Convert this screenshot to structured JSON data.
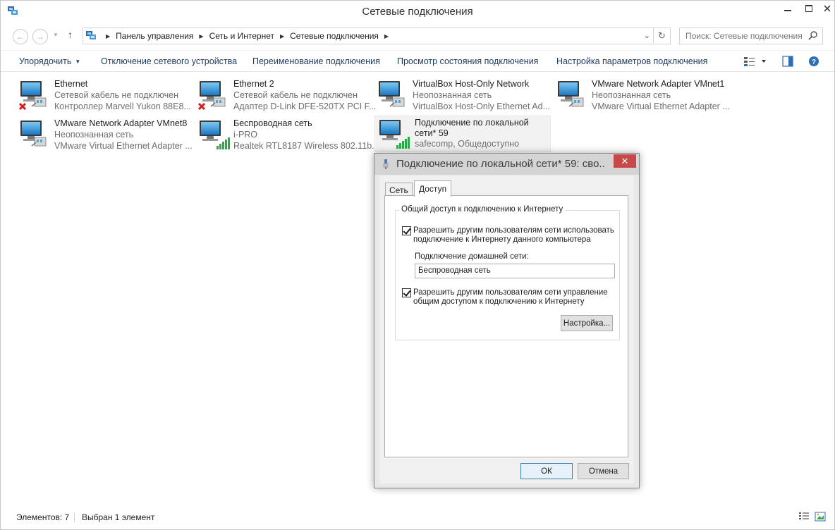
{
  "window": {
    "title": "Сетевые подключения"
  },
  "address": {
    "crumbs": [
      "Панель управления",
      "Сеть и Интернет",
      "Сетевые подключения"
    ],
    "search_placeholder": "Поиск: Сетевые подключения"
  },
  "commands": {
    "organize": "Упорядочить",
    "disable": "Отключение сетевого устройства",
    "rename": "Переименование подключения",
    "view_status": "Просмотр состояния подключения",
    "change_settings": "Настройка параметров подключения"
  },
  "connections": [
    {
      "name": "Ethernet",
      "status": "Сетевой кабель не подключен",
      "device": "Контроллер Marvell Yukon 88E8...",
      "icon": "wired-disconnected-icon"
    },
    {
      "name": "Ethernet 2",
      "status": "Сетевой кабель не подключен",
      "device": "Адаптер D-Link DFE-520TX PCI F...",
      "icon": "wired-disconnected-icon"
    },
    {
      "name": "VirtualBox Host-Only Network",
      "status": "Неопознанная сеть",
      "device": "VirtualBox Host-Only Ethernet Ad...",
      "icon": "wired-connected-icon"
    },
    {
      "name": "VMware Network Adapter VMnet1",
      "status": "Неопознанная сеть",
      "device": "VMware Virtual Ethernet Adapter ...",
      "icon": "wired-connected-icon"
    },
    {
      "name": "VMware Network Adapter VMnet8",
      "status": "Неопознанная сеть",
      "device": "VMware Virtual Ethernet Adapter ...",
      "icon": "wired-connected-icon"
    },
    {
      "name": "Беспроводная сеть",
      "status": "i-PRO",
      "device": "Realtek RTL8187 Wireless 802.11b...",
      "icon": "wireless-signal-icon"
    },
    {
      "name_line1": "Подключение по локальной",
      "name_line2": "сети* 59",
      "status": "safecomp, Общедоступно",
      "icon": "wireless-signal-icon",
      "selected": true
    }
  ],
  "status_bar": {
    "count": "Элементов: 7",
    "selection": "Выбран 1 элемент"
  },
  "dialog": {
    "title": "Подключение по локальной сети* 59: сво...",
    "tabs": [
      "Сеть",
      "Доступ"
    ],
    "active_tab": "Доступ",
    "group_title": "Общий доступ к подключению к Интернету",
    "allow_share_label": "Разрешить другим пользователям сети использовать подключение к Интернету данного компьютера",
    "allow_share_checked": true,
    "home_network_label": "Подключение домашней сети:",
    "home_network_value": "Беспроводная сеть",
    "allow_control_label": "Разрешить другим пользователям сети управление общим доступом к подключению к Интернету",
    "allow_control_checked": true,
    "settings_button": "Настройка...",
    "ok_button": "ОК",
    "cancel_button": "Отмена"
  }
}
